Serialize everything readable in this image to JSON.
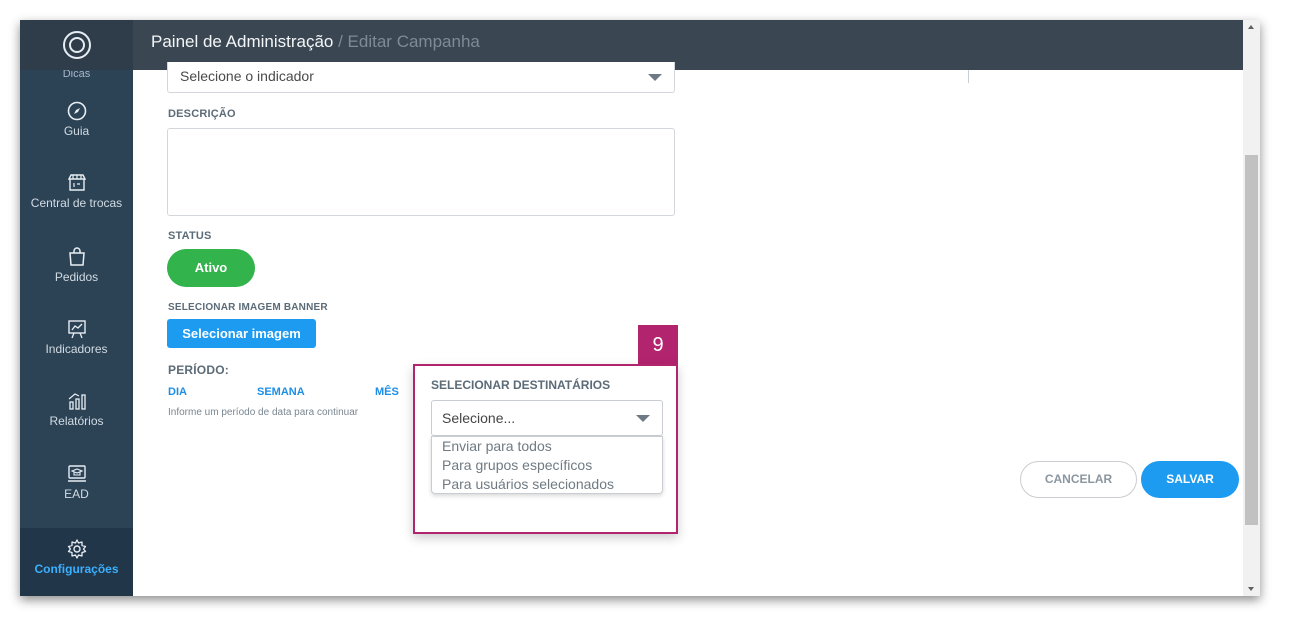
{
  "header": {
    "title": "Painel de Administração",
    "breadcrumb": " / Editar Campanha"
  },
  "sidebar": {
    "cut_item": "Dicas",
    "items": [
      {
        "label": "Guia",
        "icon": "compass-icon"
      },
      {
        "label": "Central de trocas",
        "icon": "store-icon"
      },
      {
        "label": "Pedidos",
        "icon": "bag-icon"
      },
      {
        "label": "Indicadores",
        "icon": "presentation-chart-icon"
      },
      {
        "label": "Relatórios",
        "icon": "report-chart-icon"
      },
      {
        "label": "EAD",
        "icon": "laptop-graduation-icon"
      },
      {
        "label": "Configurações",
        "icon": "gear-icon",
        "active": true
      }
    ]
  },
  "form": {
    "indicator_select": "Selecione o indicador",
    "description_label": "DESCRIÇÃO",
    "description_value": "",
    "status_label": "STATUS",
    "status_button": "Ativo",
    "banner_label": "SELECIONAR IMAGEM BANNER",
    "banner_button": "Selecionar imagem",
    "period_label": "PERÍODO:",
    "period_options": [
      "DIA",
      "SEMANA",
      "MÊS"
    ],
    "period_hint": "Informe um período de data para continuar"
  },
  "recipients": {
    "step_badge": "9",
    "label": "SELECIONAR DESTINATÁRIOS",
    "selected": "Selecione...",
    "options": [
      "Enviar para todos",
      "Para grupos específicos",
      "Para usuários selecionados"
    ]
  },
  "actions": {
    "cancel": "CANCELAR",
    "save": "SALVAR"
  },
  "colors": {
    "accent": "#1c9bf0",
    "status_active": "#32b34b",
    "highlight": "#b3246e",
    "sidebar": "#2c4255",
    "header": "#3a4651"
  }
}
